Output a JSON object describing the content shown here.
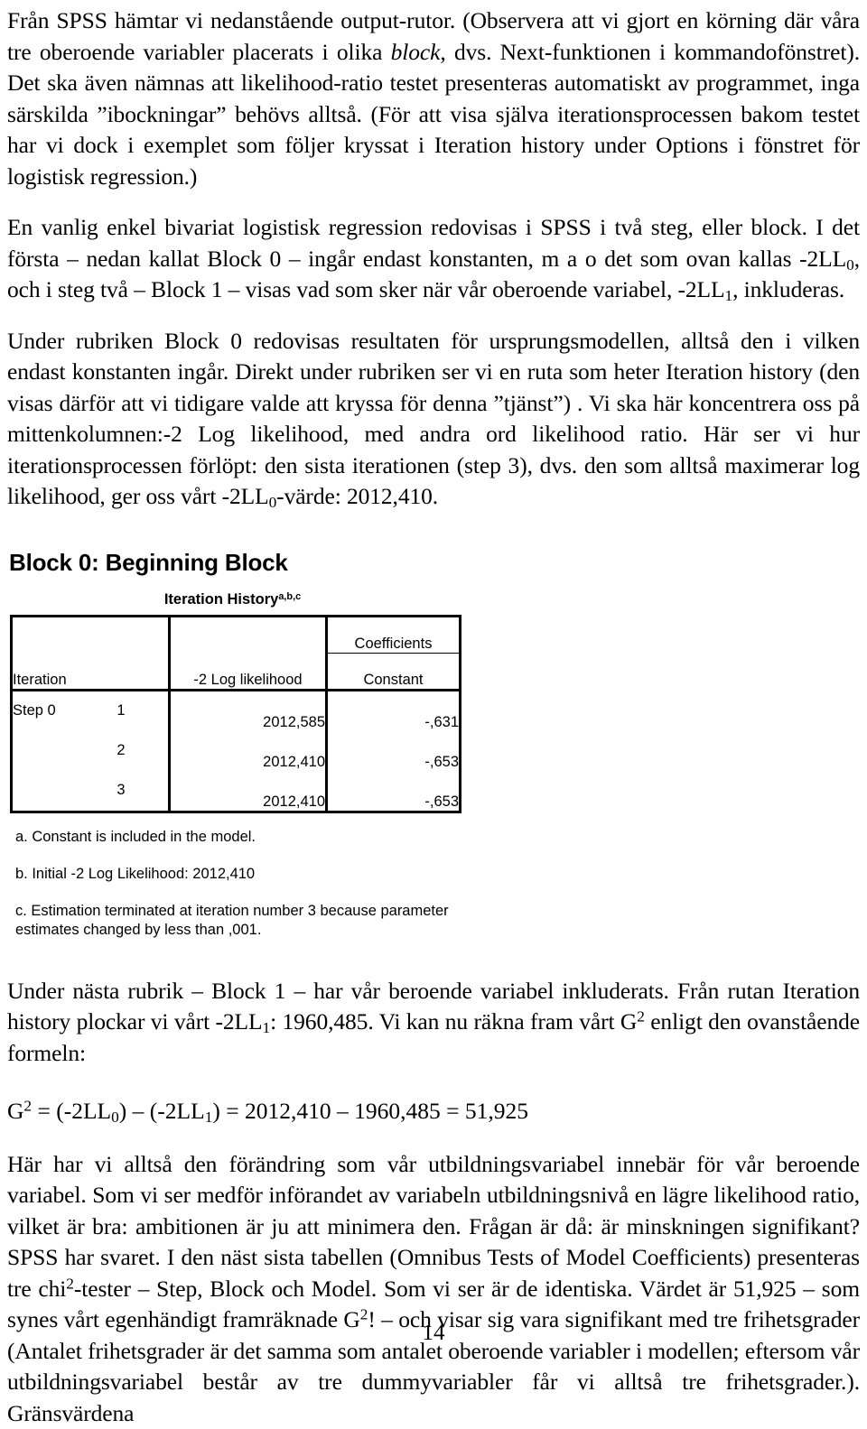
{
  "document": {
    "page_number": "14"
  },
  "paragraphs": {
    "p1_part1": "Från SPSS hämtar vi nedanstående output-rutor. (Observera att vi gjort en körning där våra tre oberoende variabler placerats i olika ",
    "p1_italic": "block",
    "p1_part2": ", dvs. Next-funktionen i kommandofönstret). Det ska även nämnas att likelihood-ratio testet presenteras automatiskt av programmet, inga särskilda ”ibockningar” behövs alltså. (För att visa själva iterationsprocessen bakom testet har vi dock i exemplet som följer kryssat i Iteration history under Options i fönstret för logistisk regression.)",
    "p2_part1": "En vanlig enkel bivariat logistisk regression redovisas i SPSS i två steg, eller block. I det första – nedan kallat Block 0 – ingår endast konstanten, m a o det som ovan kallas -2LL",
    "p2_sub1": "0",
    "p2_part2": ", och i steg två – Block 1 – visas vad som sker när vår oberoende variabel, -2LL",
    "p2_sub2": "1",
    "p2_part3": ", inkluderas.",
    "p3_part1": "Under rubriken Block 0 redovisas resultaten för ursprungsmodellen, alltså den i vilken endast konstanten ingår. Direkt under rubriken ser vi en ruta som heter Iteration history (den visas därför att vi tidigare valde att kryssa för denna ”tjänst”) . Vi ska här koncentrera oss på mittenkolumnen:-2 Log likelihood, med andra ord likelihood ratio. Här ser vi hur iterationsprocessen förlöpt: den sista iterationen (step 3), dvs. den som alltså maximerar log likelihood, ger oss vårt -2LL",
    "p3_sub1": "0",
    "p3_part2": "-värde: 2012,410.",
    "p4_part1": "Under nästa rubrik – Block 1 – har vår beroende variabel inkluderats. Från rutan Iteration history plockar vi vårt -2LL",
    "p4_sub1": "1",
    "p4_part2": ": 1960,485. Vi kan nu räkna fram vårt G",
    "p4_sup1": "2",
    "p4_part3": " enligt den ovanstående formeln:",
    "p5_part1": "Här har vi alltså den förändring som vår utbildningsvariabel innebär för vår beroende variabel. Som vi ser medför införandet av variabeln utbildningsnivå en lägre likelihood ratio, vilket är bra: ambitionen är ju att minimera den. Frågan är då: är minskningen signifikant? SPSS har svaret. I den näst sista tabellen (Omnibus Tests of Model Coefficients) presenteras tre chi",
    "p5_sup1": "2",
    "p5_part2": "-tester – Step, Block och Model. Som vi ser är de identiska. Värdet är 51,925 – som synes vårt egenhändigt framräknade G",
    "p5_sup2": "2",
    "p5_part3": "! – och visar sig vara signifikant med tre frihetsgrader (Antalet frihetsgrader är det samma som antalet oberoende variabler i modellen; eftersom vår utbildningsvariabel består av tre dummyvariabler får vi alltså tre frihetsgrader.). Gränsvärdena"
  },
  "formula": {
    "g_symbol": "G",
    "g_exp": "2",
    "eq1": " = (-2LL",
    "sub_0": "0",
    "eq2": ") – (-2LL",
    "sub_1": "1",
    "eq3": ") = 2012,410 – 1960,485 = 51,925"
  },
  "spss_output": {
    "block_heading": "Block 0: Beginning Block",
    "table": {
      "title": "Iteration History",
      "title_footnote_markers": "a,b,c",
      "headers": {
        "iteration": "Iteration",
        "log_likelihood": "-2 Log likelihood",
        "coefficients_group": "Coefficients",
        "constant": "Constant"
      },
      "rows": [
        {
          "step": "Step 0",
          "iteration": "1",
          "log_likelihood": "2012,585",
          "constant": "-,631"
        },
        {
          "step": "",
          "iteration": "2",
          "log_likelihood": "2012,410",
          "constant": "-,653"
        },
        {
          "step": "",
          "iteration": "3",
          "log_likelihood": "2012,410",
          "constant": "-,653"
        }
      ],
      "footnotes": [
        "a. Constant is included in the model.",
        "b. Initial -2 Log Likelihood: 2012,410",
        "c. Estimation terminated at iteration number 3 because parameter estimates changed by less than ,001."
      ]
    }
  },
  "chart_data": {
    "type": "table",
    "title": "Iteration History (Block 0: Beginning Block)",
    "columns": [
      "Iteration",
      "-2 Log likelihood",
      "Coefficients: Constant"
    ],
    "rows": [
      [
        "Step 0  1",
        "2012,585",
        "-,631"
      ],
      [
        "2",
        "2012,410",
        "-,653"
      ],
      [
        "3",
        "2012,410",
        "-,653"
      ]
    ]
  }
}
